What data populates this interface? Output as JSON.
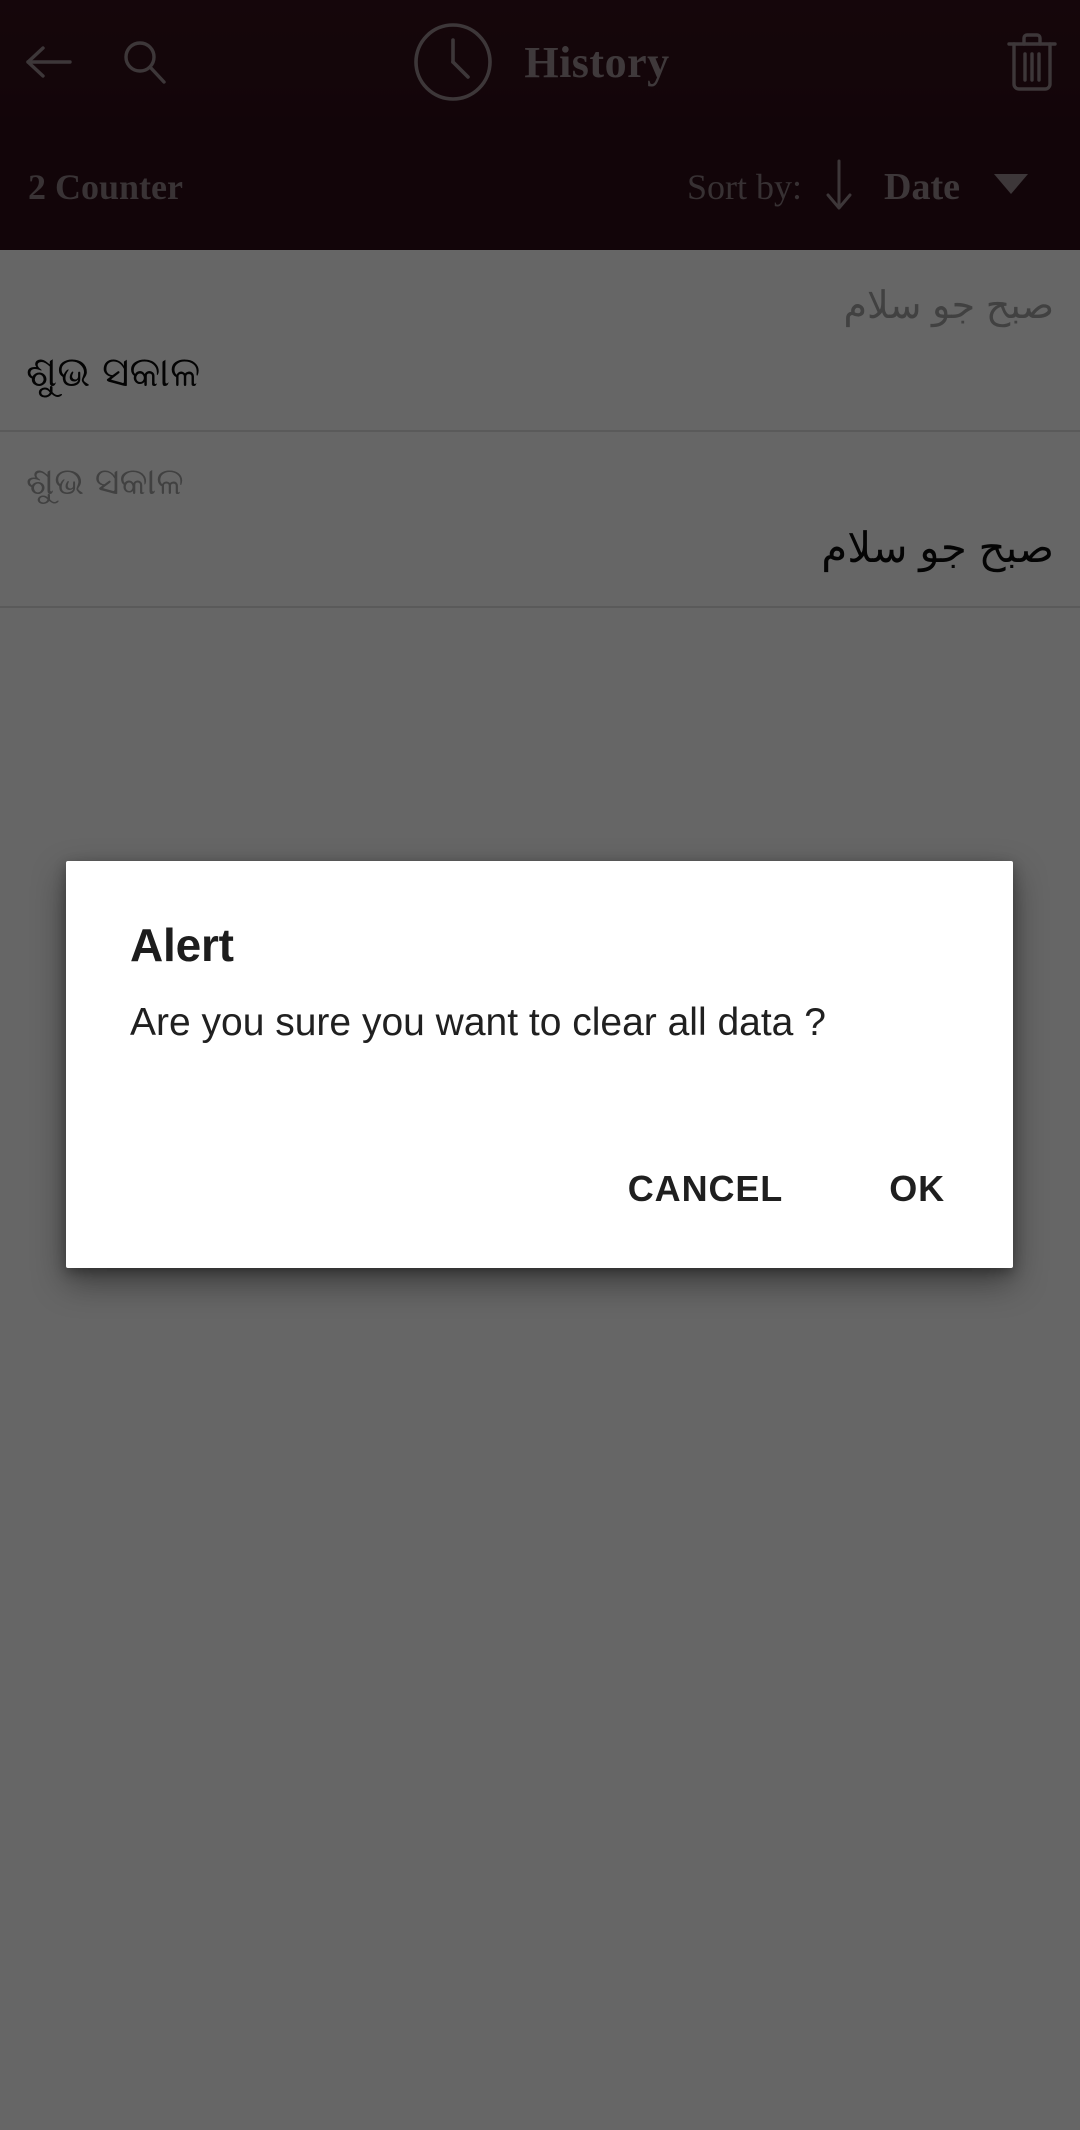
{
  "appbar": {
    "back_icon": "arrow-left-icon",
    "search_icon": "search-icon",
    "clock_icon": "clock-icon",
    "title": "History",
    "delete_icon": "trash-icon",
    "background_color": "#2f0d17",
    "foreground_color": "#9e8f94"
  },
  "sortbar": {
    "counter_text": "2 Counter",
    "sort_label": "Sort by:",
    "sort_direction_icon": "arrow-down-icon",
    "sort_value": "Date",
    "dropdown_icon": "caret-down-icon"
  },
  "list": {
    "items": [
      {
        "secondary": "صبح جو سلام",
        "secondary_dir": "rtl",
        "primary": "ଶୁଭ ସକାଳ",
        "primary_dir": "ltr"
      },
      {
        "secondary": "ଶୁଭ ସକାଳ",
        "secondary_dir": "ltr",
        "primary": "صبح جو سلام",
        "primary_dir": "rtl"
      }
    ]
  },
  "dialog": {
    "title": "Alert",
    "message": "Are you sure you want to clear all data ?",
    "cancel_label": "CANCEL",
    "ok_label": "OK",
    "background_color": "#ffffff",
    "text_color": "#1d1d1d"
  },
  "scrim": {
    "color": "#000000",
    "opacity": "0.60"
  }
}
